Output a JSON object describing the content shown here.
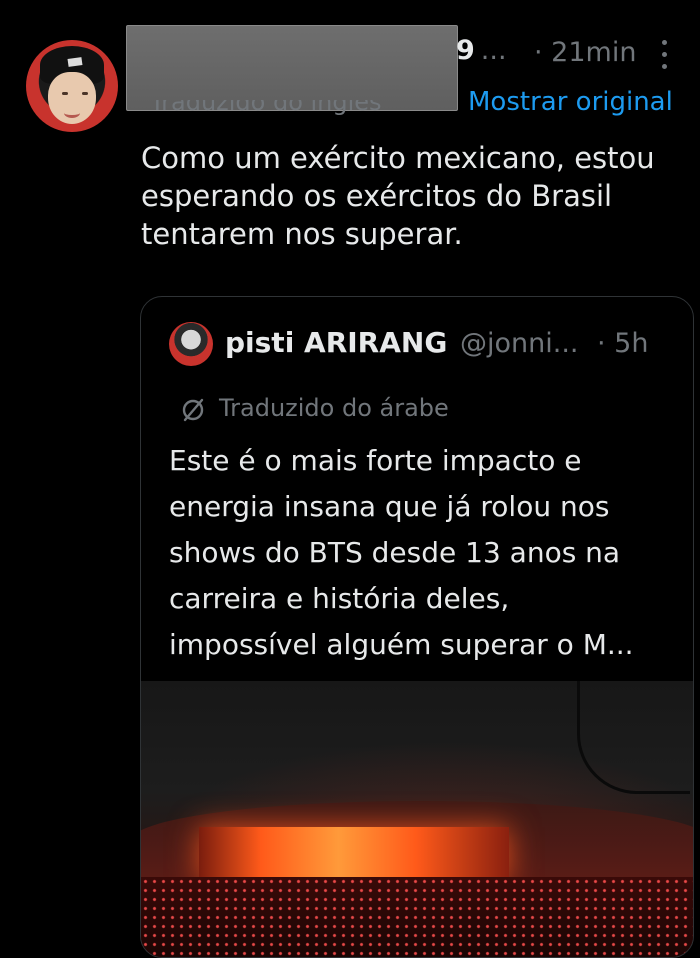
{
  "tweet": {
    "handle_tail": "9",
    "ellipsis": "...",
    "time": "· 21min",
    "translated_label": "Traduzido do inglês",
    "show_original": "Mostrar original",
    "text": "Como um exército mexicano, estou\nesperando os exércitos do Brasil\ntentarem nos superar.",
    "more_icon": "more-vertical-icon"
  },
  "quote": {
    "name": "pisti ARIRANG",
    "handle": "@jonni...",
    "time": "· 5h",
    "translated_label": "Traduzido do árabe",
    "translate_icon": "globe-slash-icon",
    "text": "Este é o mais forte impacto e\nenergia insana que já rolou nos\nshows do BTS desde 13 anos na\ncarreira e história deles,\nimpossível alguém superar o M..."
  },
  "colors": {
    "background": "#000000",
    "text": "#e7e9ea",
    "muted": "#71767b",
    "link": "#1d9bf0",
    "border": "#2f3336"
  }
}
